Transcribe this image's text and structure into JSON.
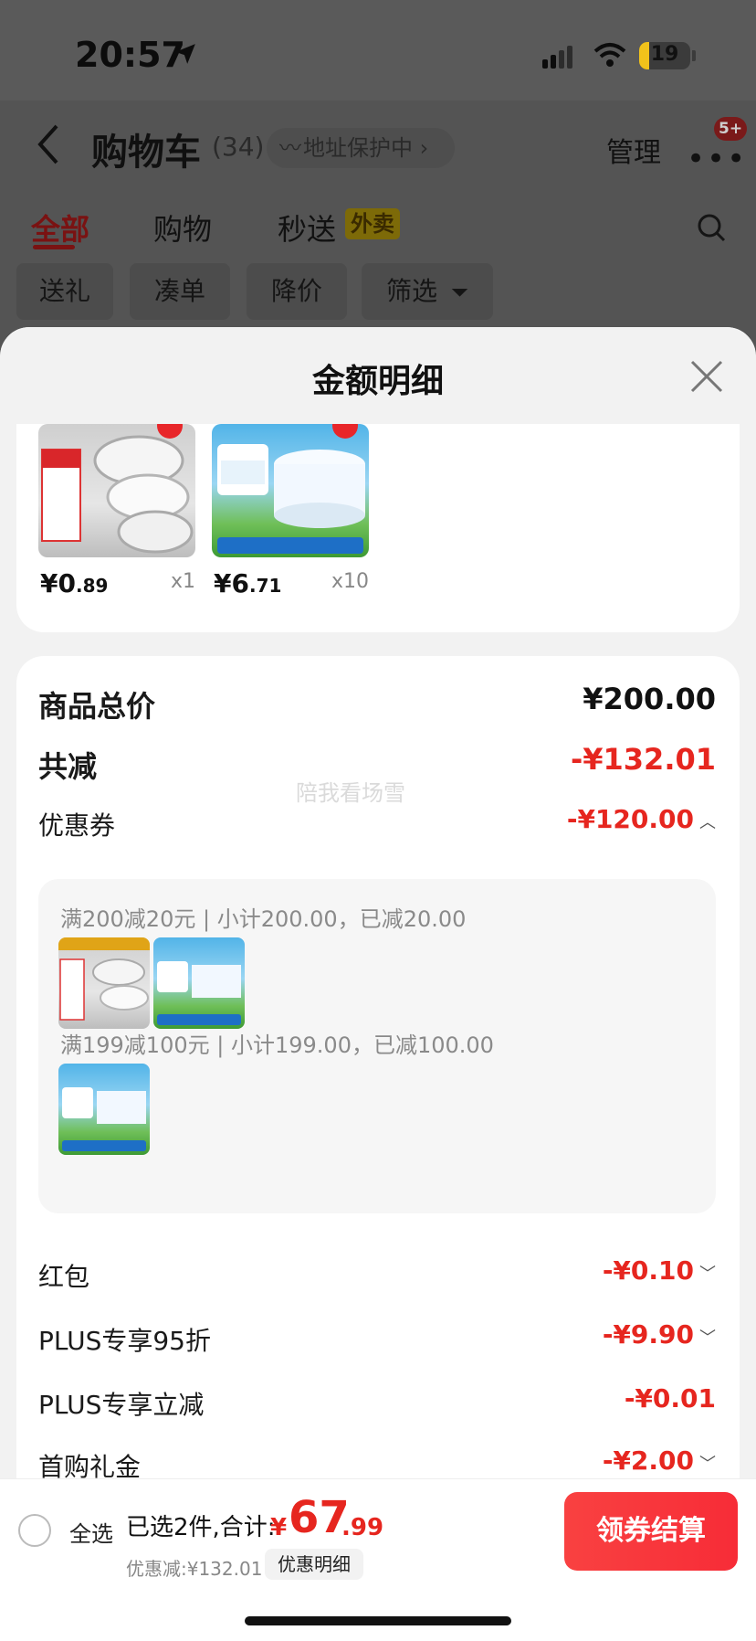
{
  "status": {
    "time": "20:57",
    "battery": "19",
    "battery_level": 0.19
  },
  "nav": {
    "title": "购物车",
    "count": "(34)",
    "address": "地址保护中",
    "manage": "管理",
    "badge": "5+"
  },
  "tabs": [
    {
      "label": "全部",
      "active": true
    },
    {
      "label": "购物",
      "active": false
    },
    {
      "label": "秒送",
      "active": false
    }
  ],
  "takeout_tag": "外卖",
  "chips": [
    "送礼",
    "凑单",
    "降价",
    "筛选"
  ],
  "sheet": {
    "title": "金额明细",
    "products": [
      {
        "price_int": "¥0",
        "price_dec": ".89",
        "qty": "x1",
        "kind": "tape"
      },
      {
        "price_int": "¥6",
        "price_dec": ".71",
        "qty": "x10",
        "kind": "yogurt"
      }
    ],
    "watermark": "陪我看场雪",
    "rows": {
      "total_label": "商品总价",
      "total_value": "¥200.00",
      "reduce_label": "共减",
      "reduce_value": "-¥132.01",
      "coupon_label": "优惠券",
      "coupon_value": "-¥120.00",
      "redpacket_label": "红包",
      "redpacket_value": "-¥0.10",
      "plus95_label": "PLUS专享95折",
      "plus95_value": "-¥9.90",
      "plusreduce_label": "PLUS专享立减",
      "plusreduce_value": "-¥0.01",
      "firstbuy_label": "首购礼金",
      "firstbuy_value": "-¥2.00"
    },
    "coupons": [
      {
        "rule": "满200减20元",
        "detail": "小计200.00，已减20.00"
      },
      {
        "rule": "满199减100元",
        "detail": "小计199.00，已减100.00"
      }
    ]
  },
  "bottom": {
    "select_all": "全选",
    "summary": "已选2件,合计:",
    "yen": "¥",
    "total_int": "67",
    "total_dec": ".99",
    "discount": "优惠减:¥132.01",
    "detail_btn": "优惠明细",
    "checkout": "领券结算"
  }
}
